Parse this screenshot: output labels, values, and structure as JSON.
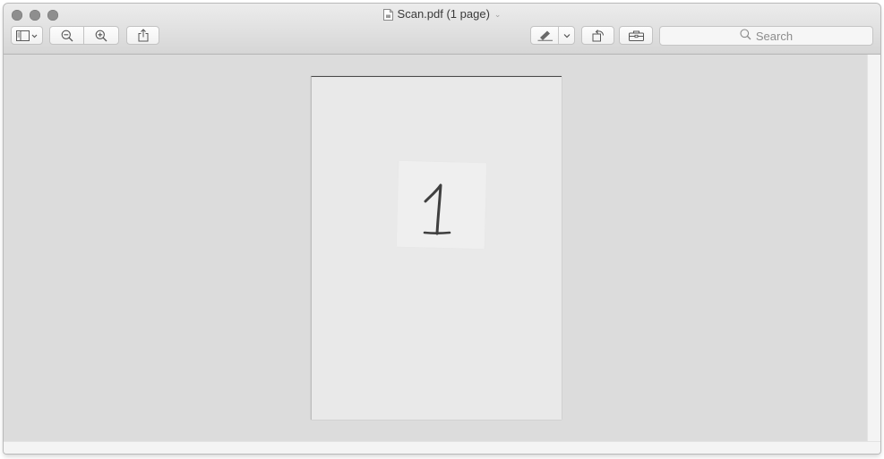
{
  "window": {
    "title": "Scan.pdf (1 page)",
    "title_chevron": "⌄"
  },
  "toolbar": {
    "search_placeholder": "Search"
  },
  "document": {
    "handwritten_content": "1"
  },
  "icons": {
    "close": "close-icon",
    "minimize": "minimize-icon",
    "zoom": "zoom-icon",
    "document": "pdf-document-icon",
    "sidebar": "sidebar-icon",
    "zoom_out": "zoom-out-icon",
    "zoom_in": "zoom-in-icon",
    "share": "share-icon",
    "markup": "pen-icon",
    "rotate": "rotate-left-icon",
    "toolbox": "toolbox-icon",
    "search": "search-icon"
  },
  "colors": {
    "traffic_inactive": "#8e8e8e",
    "content_background": "#dcdcdc",
    "page_background": "#e9e9e9"
  }
}
